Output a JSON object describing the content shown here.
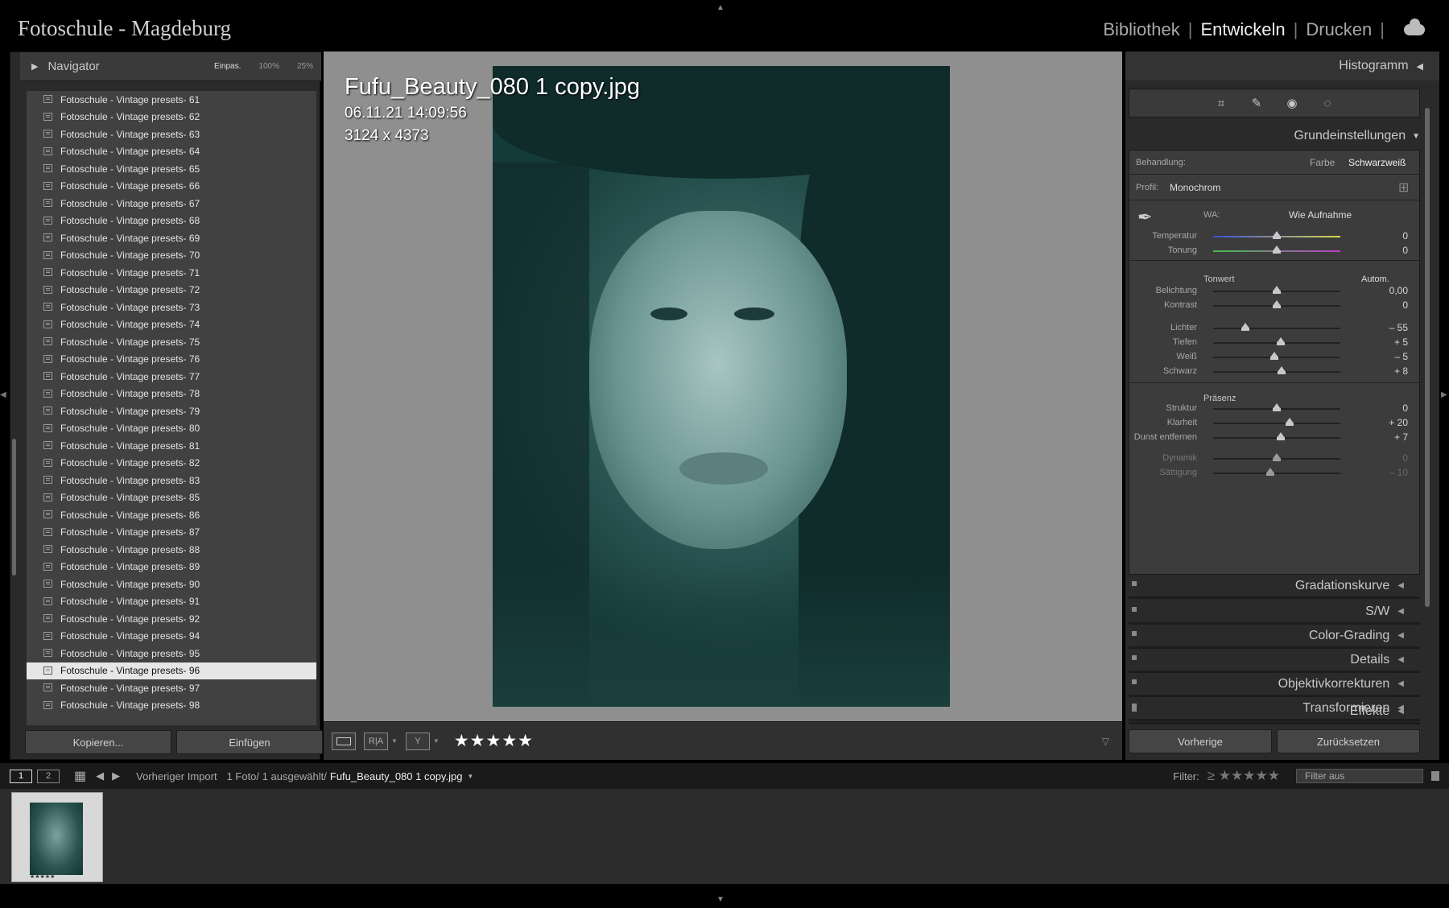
{
  "app_title": "Fotoschule - Magdeburg",
  "modules": [
    "Bibliothek",
    "Entwickeln",
    "Drucken"
  ],
  "active_module": "Entwickeln",
  "navigator": {
    "title": "Navigator",
    "zoom_options": [
      "Einpas.",
      "100%",
      "25%"
    ]
  },
  "presets": [
    "Fotoschule - Vintage presets- 61",
    "Fotoschule - Vintage presets- 62",
    "Fotoschule - Vintage presets- 63",
    "Fotoschule - Vintage presets- 64",
    "Fotoschule - Vintage presets- 65",
    "Fotoschule - Vintage presets- 66",
    "Fotoschule - Vintage presets- 67",
    "Fotoschule - Vintage presets- 68",
    "Fotoschule - Vintage presets- 69",
    "Fotoschule - Vintage presets- 70",
    "Fotoschule - Vintage presets- 71",
    "Fotoschule - Vintage presets- 72",
    "Fotoschule - Vintage presets- 73",
    "Fotoschule - Vintage presets- 74",
    "Fotoschule - Vintage presets- 75",
    "Fotoschule - Vintage presets- 76",
    "Fotoschule - Vintage presets- 77",
    "Fotoschule - Vintage presets- 78",
    "Fotoschule - Vintage presets- 79",
    "Fotoschule - Vintage presets- 80",
    "Fotoschule - Vintage presets- 81",
    "Fotoschule - Vintage presets- 82",
    "Fotoschule - Vintage presets- 83",
    "Fotoschule - Vintage presets- 85",
    "Fotoschule - Vintage presets- 86",
    "Fotoschule - Vintage presets- 87",
    "Fotoschule - Vintage presets- 88",
    "Fotoschule - Vintage presets- 89",
    "Fotoschule - Vintage presets- 90",
    "Fotoschule - Vintage presets- 91",
    "Fotoschule - Vintage presets- 92",
    "Fotoschule - Vintage presets- 94",
    "Fotoschule - Vintage presets- 95",
    "Fotoschule - Vintage presets- 96",
    "Fotoschule - Vintage presets- 97",
    "Fotoschule - Vintage presets- 98"
  ],
  "selected_preset": "Fotoschule - Vintage presets- 96",
  "left_buttons": {
    "copy": "Kopieren...",
    "paste": "Einfügen"
  },
  "photo": {
    "filename": "Fufu_Beauty_080 1 copy.jpg",
    "datetime": "06.11.21 14:09:56",
    "dimensions": "3124 x 4373",
    "rating": "★★★★★"
  },
  "right_panel": {
    "histogram": "Histogramm",
    "basic_title": "Grundeinstellungen",
    "treatment_label": "Behandlung:",
    "treatment_color": "Farbe",
    "treatment_bw": "Schwarzweiß",
    "profile_label": "Profil:",
    "profile_value": "Monochrom",
    "wb_label": "WA:",
    "wb_value": "Wie Aufnahme",
    "tone_label": "Tonwert",
    "auto_label": "Autom.",
    "presence_label": "Präsenz",
    "sliders": [
      {
        "label": "Temperatur",
        "value": "0",
        "pos": 0.5
      },
      {
        "label": "Tonung",
        "value": "0",
        "pos": 0.5
      },
      {
        "label": "Belichtung",
        "value": "0,00",
        "pos": 0.5
      },
      {
        "label": "Kontrast",
        "value": "0",
        "pos": 0.5
      },
      {
        "label": "Lichter",
        "value": "– 55",
        "pos": 0.25
      },
      {
        "label": "Tiefen",
        "value": "+ 5",
        "pos": 0.53
      },
      {
        "label": "Weiß",
        "value": "– 5",
        "pos": 0.48
      },
      {
        "label": "Schwarz",
        "value": "+ 8",
        "pos": 0.54
      },
      {
        "label": "Struktur",
        "value": "0",
        "pos": 0.5
      },
      {
        "label": "Klarheit",
        "value": "+ 20",
        "pos": 0.6
      },
      {
        "label": "Dunst entfernen",
        "value": "+ 7",
        "pos": 0.53
      },
      {
        "label": "Dynamik",
        "value": "0",
        "pos": 0.5
      },
      {
        "label": "Sättigung",
        "value": "– 10",
        "pos": 0.45
      }
    ],
    "collapsed_panels": [
      "Gradationskurve",
      "S/W",
      "Color-Grading",
      "Details",
      "Objektivkorrekturen",
      "Transformieren",
      "Effekte"
    ],
    "prev_button": "Vorherige",
    "reset_button": "Zurücksetzen"
  },
  "filmbar": {
    "pages": [
      "1",
      "2"
    ],
    "source": "Vorheriger Import",
    "count": "1 Foto/ 1 ausgewählt/",
    "file": "Fufu_Beauty_080 1 copy.jpg",
    "filter_label": "Filter:",
    "filter_value": "Filter aus",
    "stars": "≥ ★★★★★",
    "thumb_stars": "★★★★★"
  }
}
